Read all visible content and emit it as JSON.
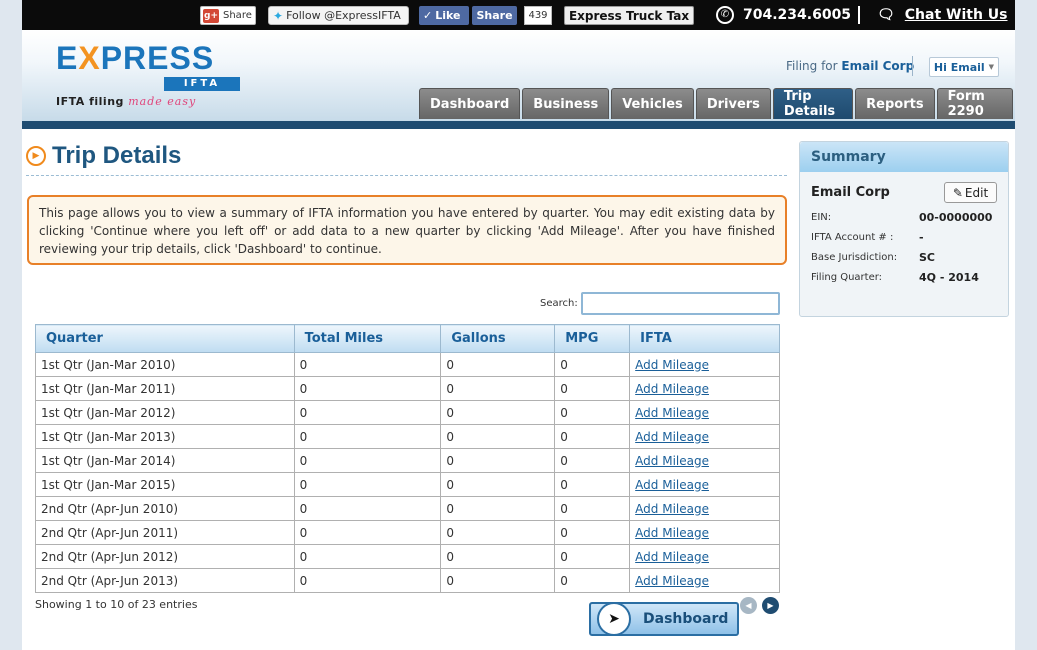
{
  "topbar": {
    "google_share": "Share",
    "google_icon": "g+",
    "twitter_follow": "Follow @ExpressIFTA",
    "fb_like": "Like",
    "fb_share": "Share",
    "fb_count": "439",
    "express_truck_tax": "Express Truck Tax",
    "phone": "704.234.6005",
    "chat": "Chat With Us"
  },
  "logo": {
    "ex_e": "E",
    "ex_x": "X",
    "ex_rest": "PRESS",
    "sub": "IFTA",
    "tag_main": "IFTA filing",
    "tag_made": "made easy"
  },
  "header": {
    "filing_for_label": "Filing for",
    "filing_for_company": "Email Corp",
    "user_greeting": "Hi Email"
  },
  "tabs": [
    "Dashboard",
    "Business",
    "Vehicles",
    "Drivers",
    "Trip Details",
    "Reports",
    "Form 2290"
  ],
  "active_tab": "Trip Details",
  "page": {
    "title": "Trip Details",
    "info": "This page allows you to view a summary of IFTA information you have entered by quarter. You may edit existing data by clicking 'Continue where you left off' or add data to a new quarter by clicking 'Add Mileage'. After you have finished reviewing your trip details, click 'Dashboard' to continue.",
    "search_label": "Search:",
    "search_value": ""
  },
  "table": {
    "headers": [
      "Quarter",
      "Total Miles",
      "Gallons",
      "MPG",
      "IFTA"
    ],
    "rows": [
      {
        "quarter": "1st Qtr (Jan-Mar 2010)",
        "miles": "0",
        "gallons": "0",
        "mpg": "0",
        "action": "Add Mileage"
      },
      {
        "quarter": "1st Qtr (Jan-Mar 2011)",
        "miles": "0",
        "gallons": "0",
        "mpg": "0",
        "action": "Add Mileage"
      },
      {
        "quarter": "1st Qtr (Jan-Mar 2012)",
        "miles": "0",
        "gallons": "0",
        "mpg": "0",
        "action": "Add Mileage"
      },
      {
        "quarter": "1st Qtr (Jan-Mar 2013)",
        "miles": "0",
        "gallons": "0",
        "mpg": "0",
        "action": "Add Mileage"
      },
      {
        "quarter": "1st Qtr (Jan-Mar 2014)",
        "miles": "0",
        "gallons": "0",
        "mpg": "0",
        "action": "Add Mileage"
      },
      {
        "quarter": "1st Qtr (Jan-Mar 2015)",
        "miles": "0",
        "gallons": "0",
        "mpg": "0",
        "action": "Add Mileage"
      },
      {
        "quarter": "2nd Qtr (Apr-Jun 2010)",
        "miles": "0",
        "gallons": "0",
        "mpg": "0",
        "action": "Add Mileage"
      },
      {
        "quarter": "2nd Qtr (Apr-Jun 2011)",
        "miles": "0",
        "gallons": "0",
        "mpg": "0",
        "action": "Add Mileage"
      },
      {
        "quarter": "2nd Qtr (Apr-Jun 2012)",
        "miles": "0",
        "gallons": "0",
        "mpg": "0",
        "action": "Add Mileage"
      },
      {
        "quarter": "2nd Qtr (Apr-Jun 2013)",
        "miles": "0",
        "gallons": "0",
        "mpg": "0",
        "action": "Add Mileage"
      }
    ],
    "showing": "Showing 1 to 10 of 23 entries"
  },
  "dashboard_button": "Dashboard",
  "summary": {
    "title": "Summary",
    "company": "Email Corp",
    "edit_label": "Edit",
    "fields": [
      {
        "label": "EIN:",
        "value": "00-0000000"
      },
      {
        "label": "IFTA Account # :",
        "value": "-"
      },
      {
        "label": "Base Jurisdiction:",
        "value": "SC"
      },
      {
        "label": "Filing Quarter:",
        "value": "4Q - 2014"
      }
    ]
  },
  "icons": {
    "phone": "phone-icon",
    "chat": "chat-bubbles-icon",
    "title": "play-circle-icon",
    "edit": "pencil-icon"
  }
}
